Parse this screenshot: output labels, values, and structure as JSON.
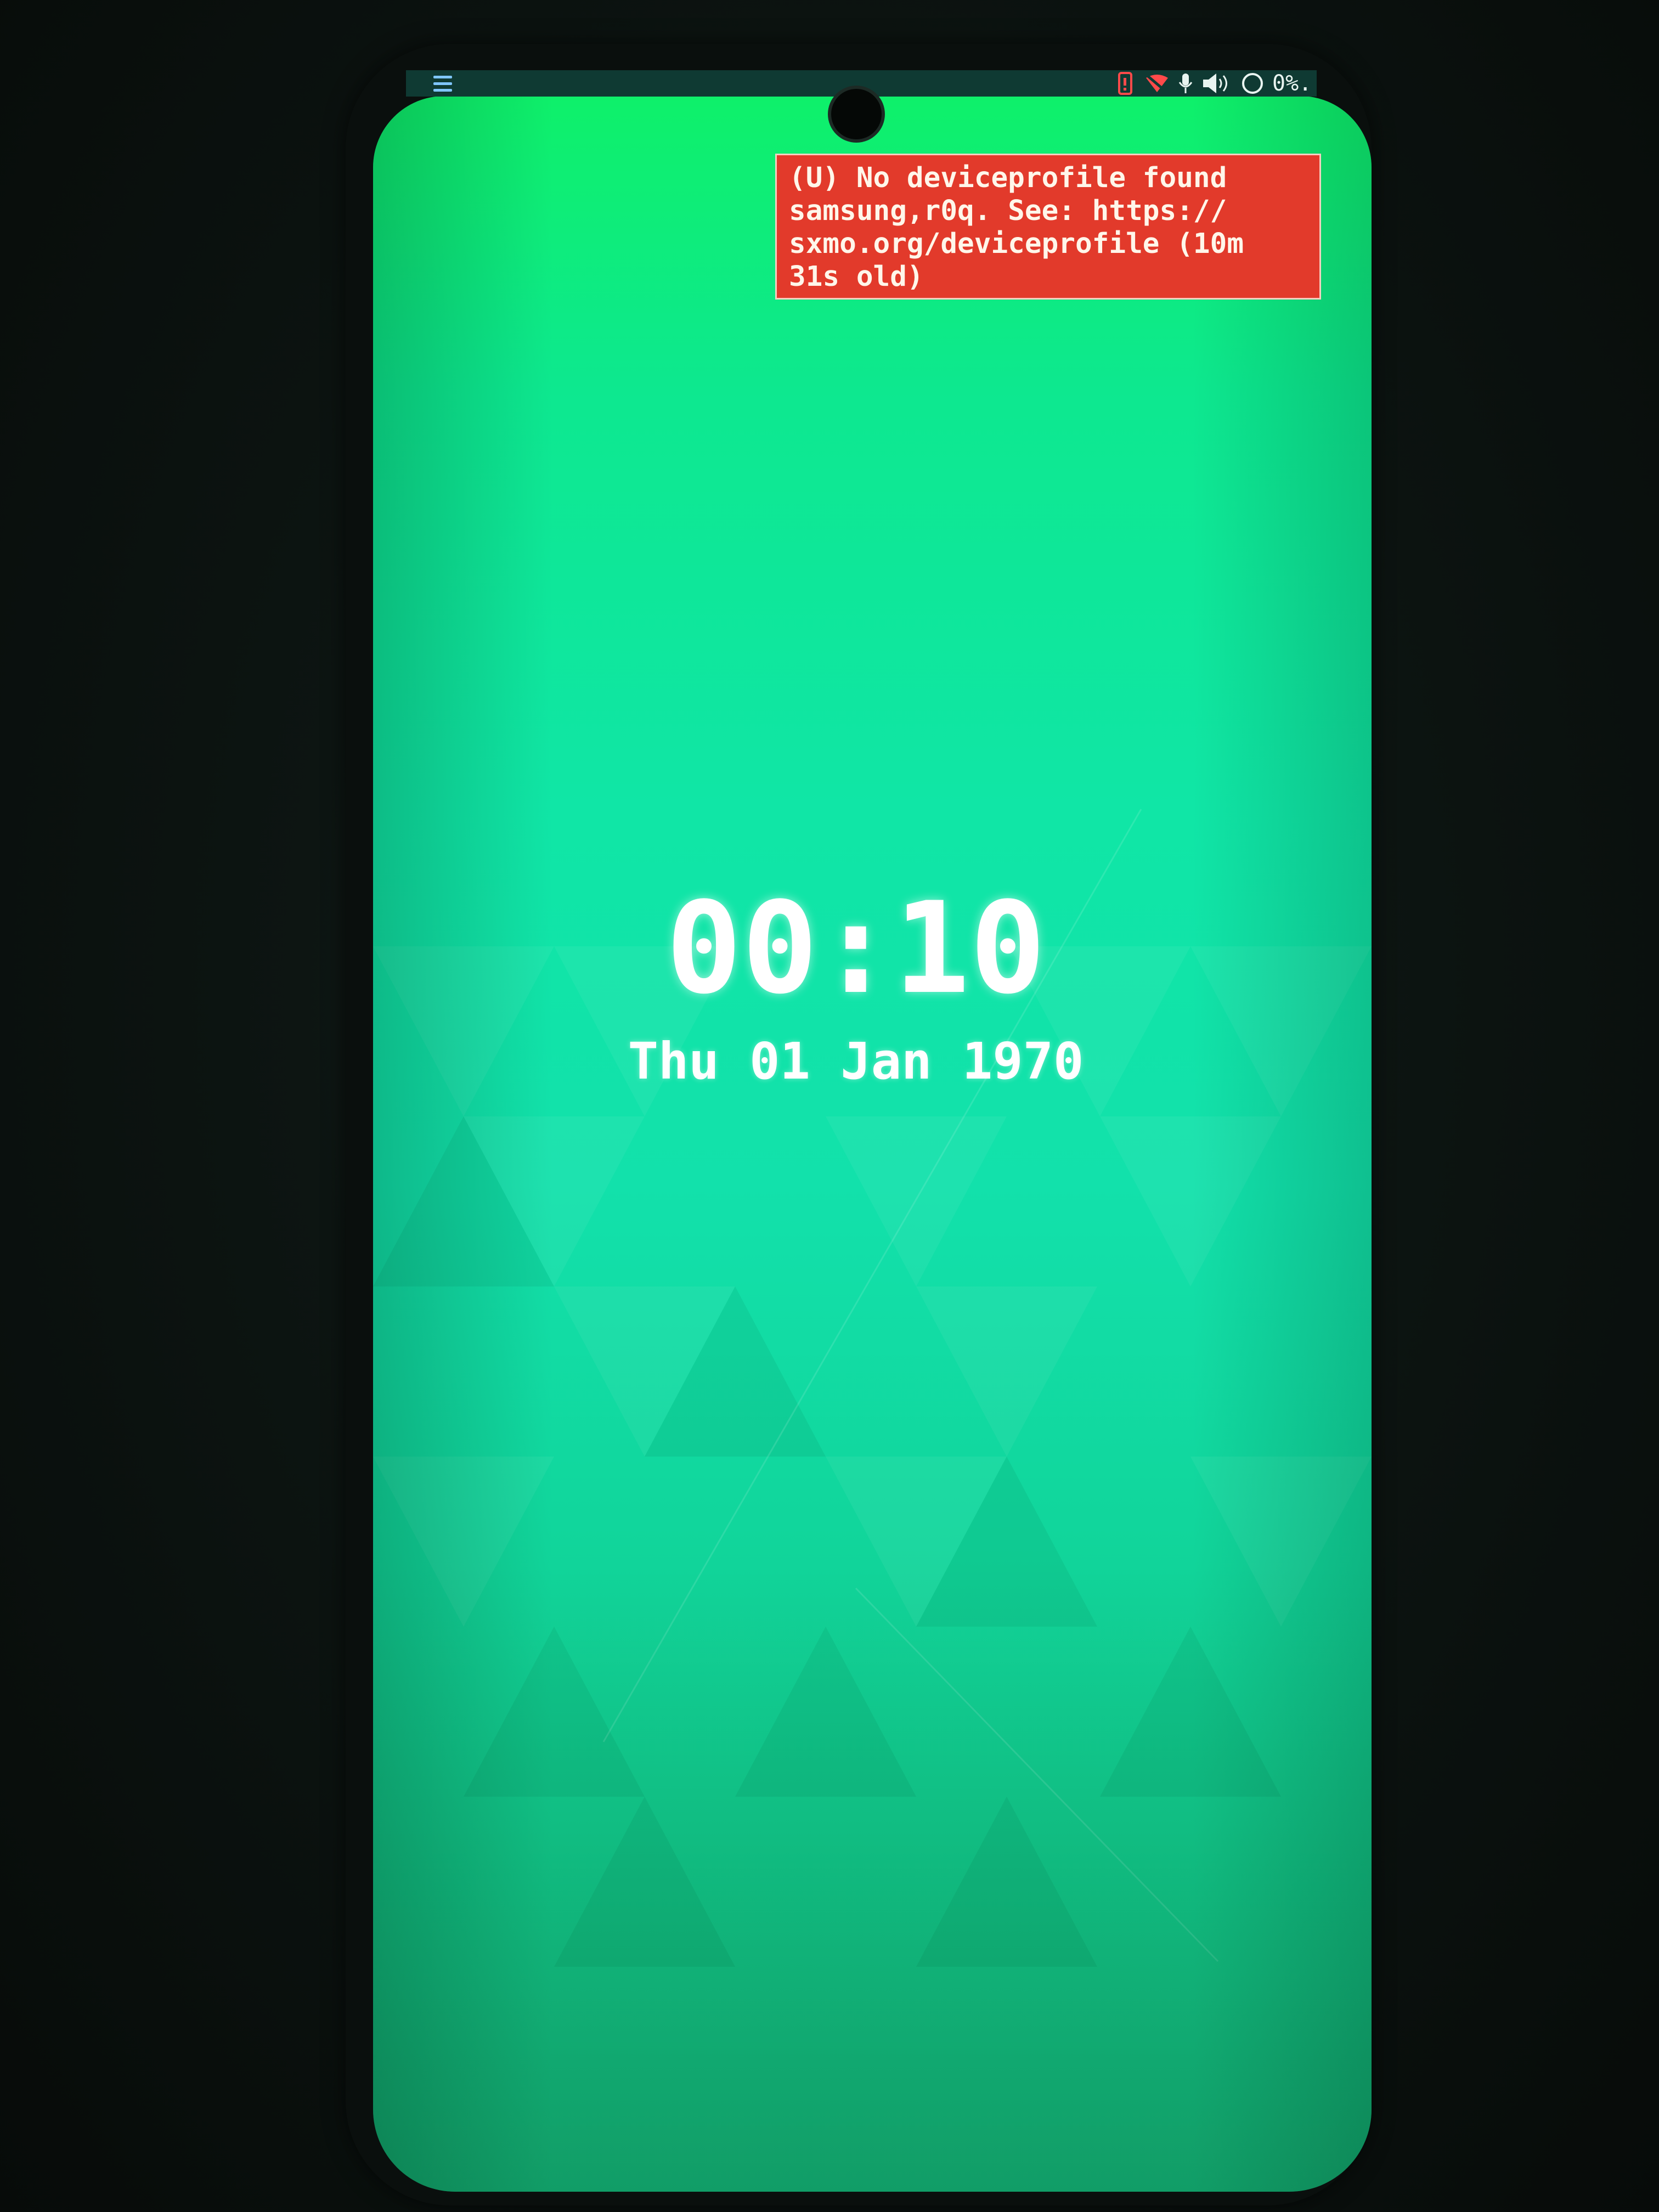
{
  "status_bar": {
    "menu_icon": "hamburger-menu-icon",
    "icons": [
      "phone-alert-icon",
      "wifi-off-icon",
      "microphone-icon",
      "volume-icon",
      "brightness-icon"
    ],
    "text": "0%."
  },
  "notification": {
    "lines": [
      "(U) No deviceprofile found",
      "samsung,r0q. See: https://",
      "sxmo.org/deviceprofile (10m",
      "31s old)"
    ],
    "color": "#e23a2b"
  },
  "lockscreen": {
    "time": "00:10",
    "date": "Thu 01 Jan 1970"
  },
  "colors": {
    "wallpaper_top": "#0ef06a",
    "wallpaper_mid": "#12e1ab",
    "status_bar": "#0f3a33"
  }
}
